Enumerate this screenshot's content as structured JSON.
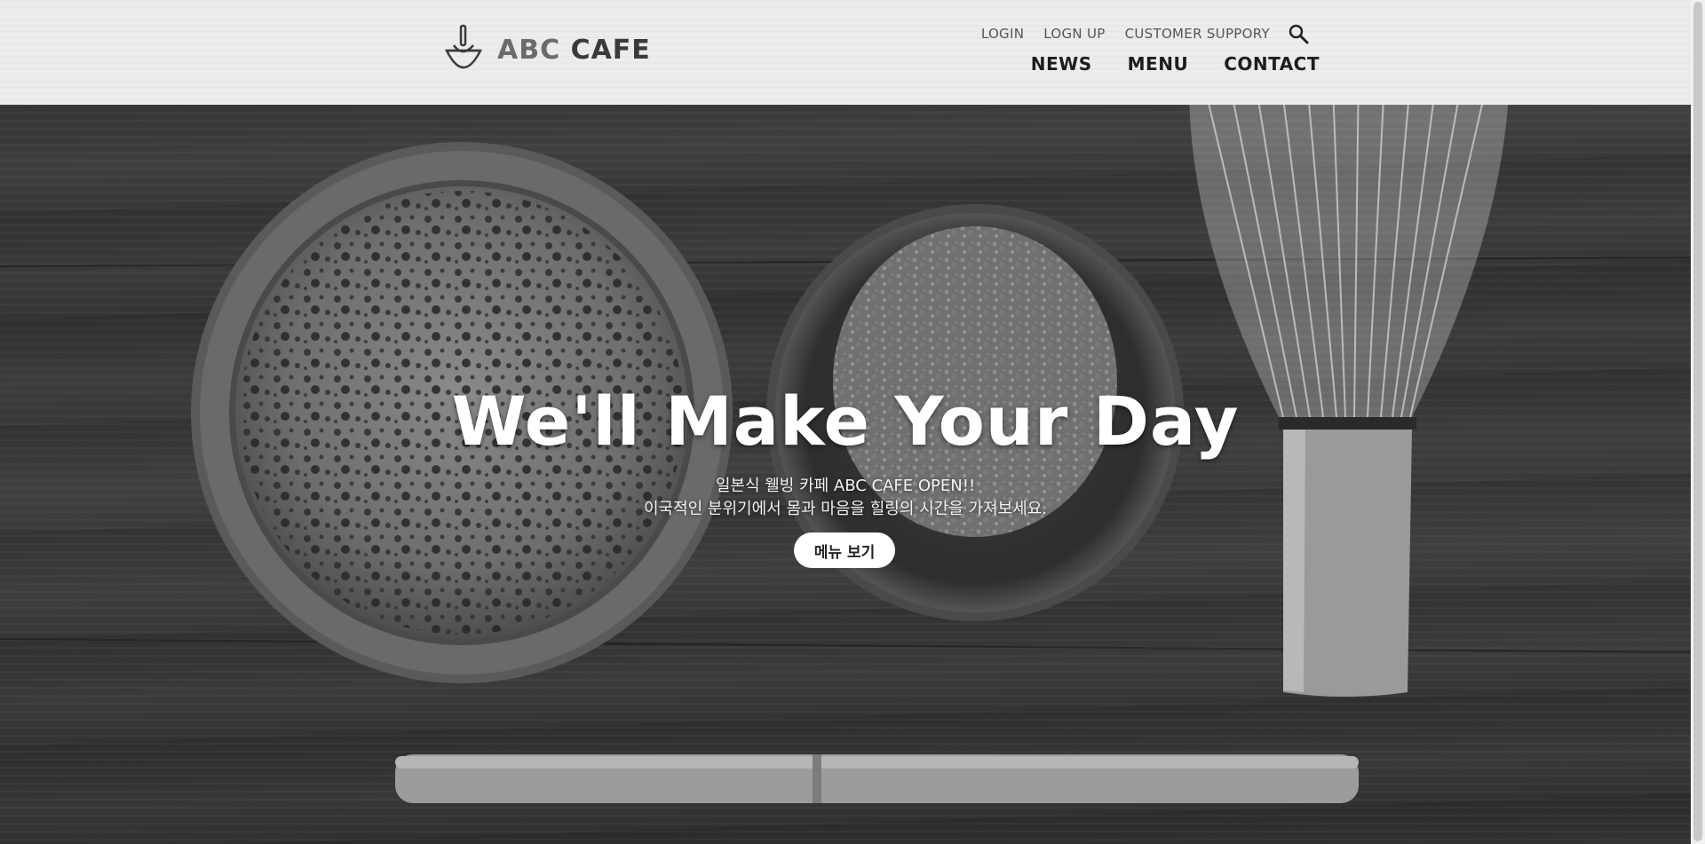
{
  "brand": {
    "name_light": "ABC",
    "name_bold": "CAFE"
  },
  "util_nav": [
    {
      "label": "LOGIN"
    },
    {
      "label": "LOGN UP"
    },
    {
      "label": "CUSTOMER SUPPORY"
    }
  ],
  "main_nav": [
    {
      "label": "NEWS"
    },
    {
      "label": "MENU"
    },
    {
      "label": "CONTACT"
    }
  ],
  "hero": {
    "title": "We'll Make Your Day",
    "line1": "일본식 웰빙 카페 ABC CAFE OPEN!!",
    "line2": "이국적인 분위기에서 몸과 마음을 힐링의 시간을 가져보세요.",
    "button_label": "메뉴 보기"
  },
  "icons": {
    "search": "search-icon",
    "logo": "matcha-bowl-whisk-icon"
  },
  "colors": {
    "header_bg": "#ececec",
    "nav_text": "#1d1d1d",
    "button_bg": "#ffffff"
  }
}
